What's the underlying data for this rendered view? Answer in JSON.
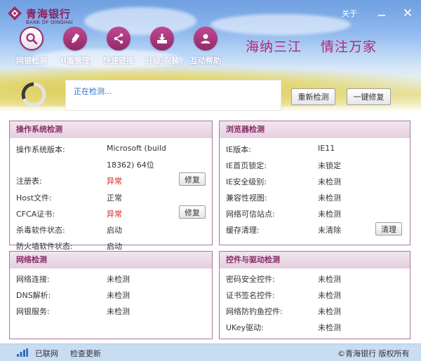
{
  "app": {
    "logo_cn": "青海银行",
    "logo_en": "BANK OF QINGHAI",
    "about": "关于"
  },
  "nav": {
    "items": [
      {
        "label": "网银检测",
        "icon": "search-icon"
      },
      {
        "label": "U盾管理",
        "icon": "usb-key-icon"
      },
      {
        "label": "快速链接",
        "icon": "share-icon"
      },
      {
        "label": "升级/安装",
        "icon": "download-icon"
      },
      {
        "label": "互动帮助",
        "icon": "user-icon"
      }
    ]
  },
  "slogan": {
    "left": "海纳三江",
    "right": "情注万家"
  },
  "scan": {
    "status": "正在检测...",
    "rescan": "重新检测",
    "one_click_fix": "一键修复"
  },
  "os_panel": {
    "title": "操作系统检测",
    "rows": [
      {
        "label": "操作系统版本:",
        "value": "Microsoft  (build",
        "value2": "18362) 64位"
      },
      {
        "label": "注册表:",
        "value": "异常",
        "action": "修复"
      },
      {
        "label": "Host文件:",
        "value": "正常"
      },
      {
        "label": "CFCA证书:",
        "value": "异常",
        "action": "修复"
      },
      {
        "label": "杀毒软件状态:",
        "value": "启动"
      },
      {
        "label": "防火墙软件状态:",
        "value": "启动"
      }
    ]
  },
  "browser_panel": {
    "title": "浏览器检测",
    "rows": [
      {
        "label": "IE版本:",
        "value": "IE11"
      },
      {
        "label": "IE首页锁定:",
        "value": "未锁定"
      },
      {
        "label": "IE安全级别:",
        "value": "未检测"
      },
      {
        "label": "兼容性视图:",
        "value": "未检测"
      },
      {
        "label": "网络可信站点:",
        "value": "未检测"
      },
      {
        "label": "缓存清理:",
        "value": "未清除",
        "action": "清理"
      }
    ]
  },
  "network_panel": {
    "title": "网络检测",
    "rows": [
      {
        "label": "网络连接:",
        "value": "未检测"
      },
      {
        "label": "DNS解析:",
        "value": "未检测"
      },
      {
        "label": "网银服务:",
        "value": "未检测"
      }
    ]
  },
  "driver_panel": {
    "title": "控件与驱动检测",
    "rows": [
      {
        "label": "密码安全控件:",
        "value": "未检测"
      },
      {
        "label": "证书签名控件:",
        "value": "未检测"
      },
      {
        "label": "网络防钓鱼控件:",
        "value": "未检测"
      },
      {
        "label": "UKey驱动:",
        "value": "未检测"
      }
    ]
  },
  "footer": {
    "connected": "已联网",
    "check_update": "检查更新",
    "copyright": "©青海银行 版权所有"
  },
  "colors": {
    "brand": "#9a2c6e",
    "error": "#d42424",
    "link": "#2f6fc4"
  }
}
